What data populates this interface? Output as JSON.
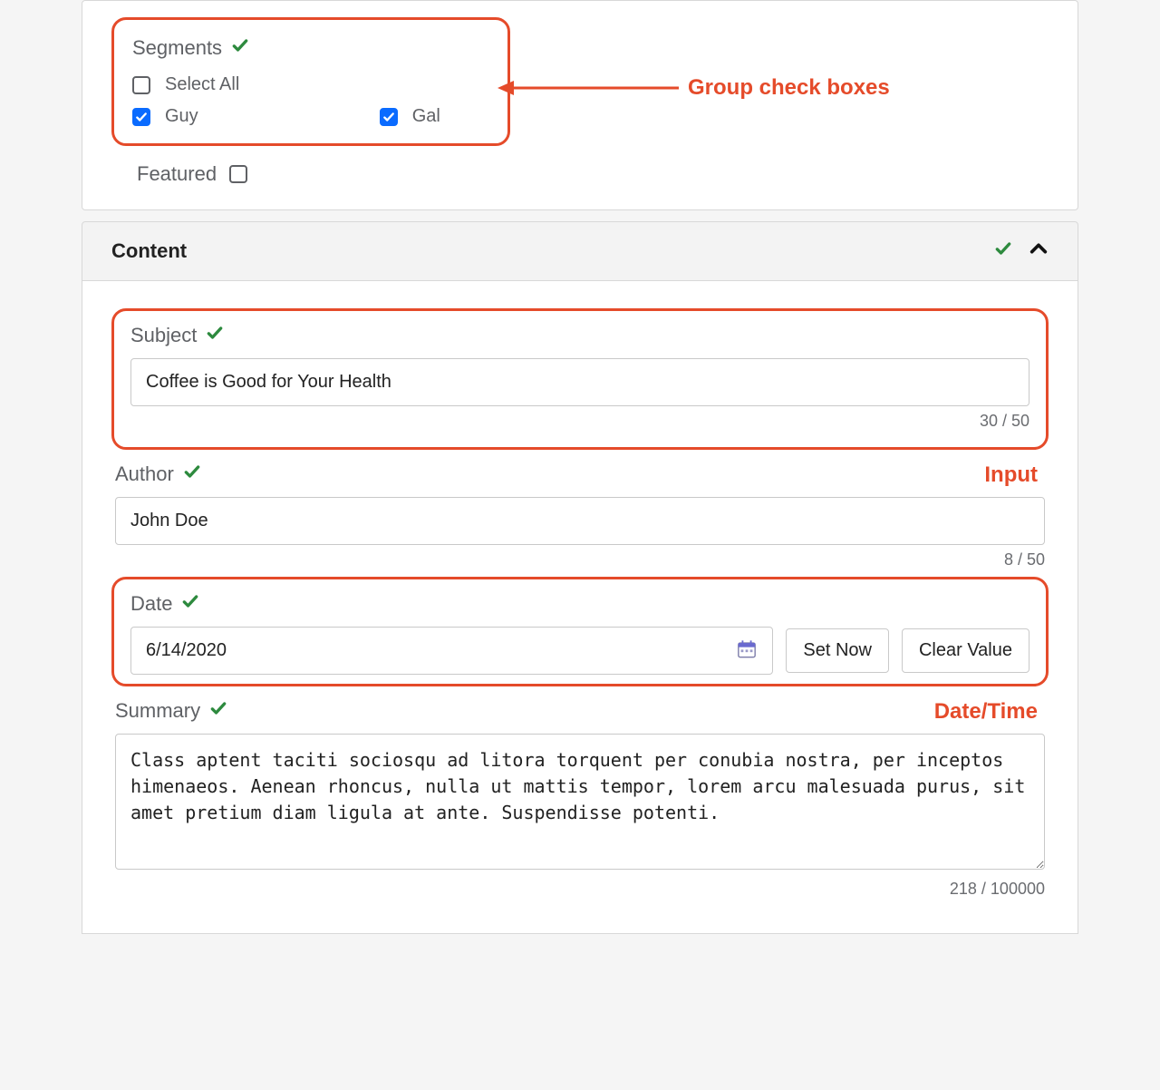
{
  "segments": {
    "title": "Segments",
    "selectAll": {
      "label": "Select All",
      "checked": false
    },
    "items": [
      {
        "label": "Guy",
        "checked": true
      },
      {
        "label": "Gal",
        "checked": true
      }
    ]
  },
  "featured": {
    "label": "Featured",
    "checked": false
  },
  "annotations": {
    "groupCheckboxes": "Group check boxes",
    "input": "Input",
    "dateTime": "Date/Time"
  },
  "contentSection": {
    "title": "Content"
  },
  "subject": {
    "label": "Subject",
    "value": "Coffee is Good for Your Health",
    "counter": "30 / 50"
  },
  "author": {
    "label": "Author",
    "value": "John Doe",
    "counter": "8 / 50"
  },
  "dateField": {
    "label": "Date",
    "value": "6/14/2020",
    "setNow": "Set Now",
    "clearValue": "Clear Value"
  },
  "summary": {
    "label": "Summary",
    "value": "Class aptent taciti sociosqu ad litora torquent per conubia nostra, per inceptos himenaeos. Aenean rhoncus, nulla ut mattis tempor, lorem arcu malesuada purus, sit amet pretium diam ligula at ante. Suspendisse potenti.",
    "counter": "218 / 100000"
  },
  "colors": {
    "accent": "#e54b2a",
    "checkbox": "#0a6bff",
    "valid": "#2d8a3e"
  }
}
